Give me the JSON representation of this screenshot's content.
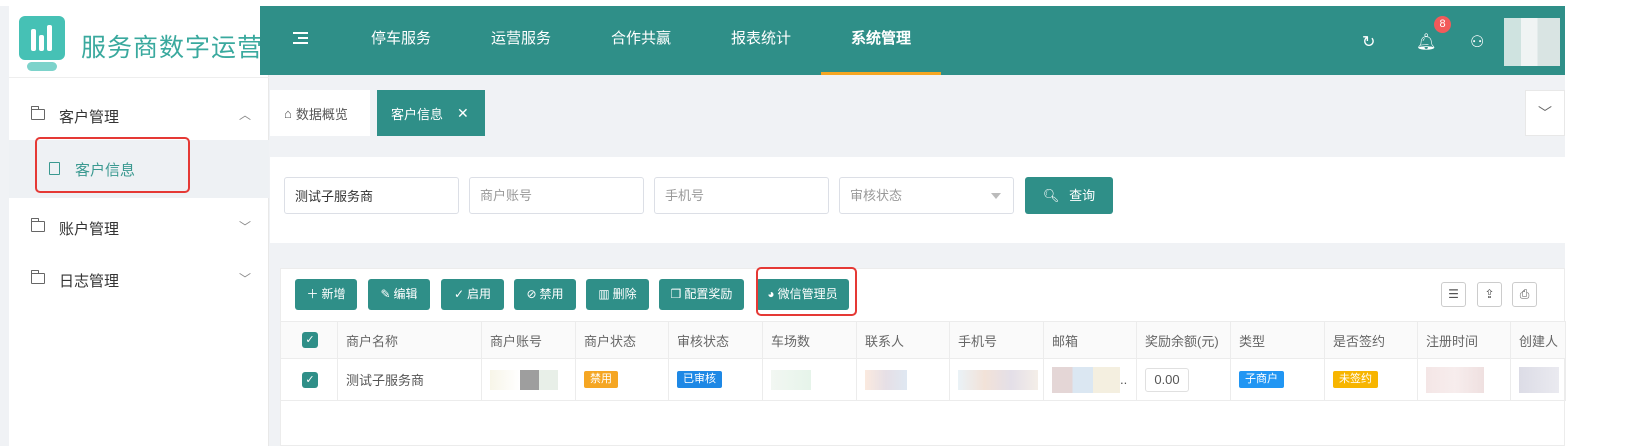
{
  "app": {
    "title": "服务商数字运营"
  },
  "header": {
    "nav": [
      {
        "label": "停车服务"
      },
      {
        "label": "运营服务"
      },
      {
        "label": "合作共赢"
      },
      {
        "label": "报表统计"
      },
      {
        "label": "系统管理",
        "active": true
      }
    ],
    "notification_count": "8"
  },
  "sidebar": {
    "groups": [
      {
        "label": "客户管理",
        "expanded": true
      },
      {
        "label": "账户管理"
      },
      {
        "label": "日志管理"
      }
    ],
    "sub_items": [
      {
        "label": "客户信息",
        "active": true
      }
    ]
  },
  "tabs": [
    {
      "label": "数据概览"
    },
    {
      "label": "客户信息",
      "active": true
    }
  ],
  "search": {
    "name_value": "测试子服务商",
    "account_placeholder": "商户账号",
    "phone_placeholder": "手机号",
    "audit_placeholder": "审核状态",
    "query_label": "查询"
  },
  "toolbar": {
    "add": "新增",
    "edit": "编辑",
    "enable": "启用",
    "disable": "禁用",
    "delete": "删除",
    "reward": "配置奖励",
    "wechat": "微信管理员"
  },
  "table": {
    "columns": [
      "商户名称",
      "商户账号",
      "商户状态",
      "审核状态",
      "车场数",
      "联系人",
      "手机号",
      "邮箱",
      "奖励余额(元)",
      "类型",
      "是否签约",
      "注册时间",
      "创建人"
    ],
    "rows": [
      {
        "name": "测试子服务商",
        "status": "禁用",
        "audit": "已审核",
        "email_suffix": "..",
        "reward_balance": "0.00",
        "type": "子商户",
        "signed": "未签约"
      }
    ]
  },
  "colors": {
    "primary": "#2f8f88",
    "accent": "#f5a623",
    "tag_disabled": "#f5a623",
    "tag_audited": "#1e88e5",
    "tag_sub": "#2196f3",
    "tag_unsigned": "#f7b500",
    "highlight": "#e53935"
  }
}
